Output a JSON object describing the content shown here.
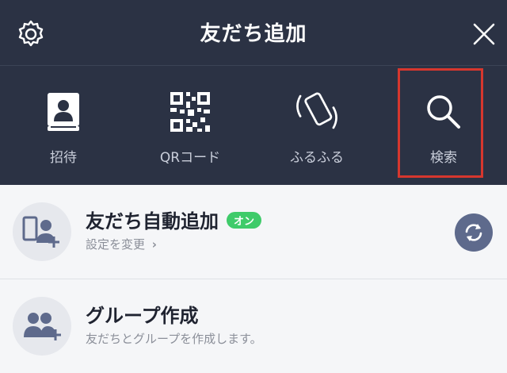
{
  "header": {
    "title": "友だち追加",
    "icons": {
      "left": "gear-icon",
      "right": "close-icon"
    },
    "tabs": [
      {
        "label": "招待",
        "icon": "contact-book-icon"
      },
      {
        "label": "QRコード",
        "icon": "qr-code-icon"
      },
      {
        "label": "ふるふる",
        "icon": "shake-phone-icon"
      },
      {
        "label": "検索",
        "icon": "search-icon"
      }
    ]
  },
  "list": {
    "auto_add": {
      "title": "友だち自動追加",
      "badge": "オン",
      "subtitle": "設定を変更",
      "chevron": "›",
      "icon": "phone-user-add-icon",
      "action_icon": "sync-icon"
    },
    "group": {
      "title": "グループ作成",
      "subtitle": "友だちとグループを作成します。",
      "icon": "group-add-icon"
    }
  },
  "colors": {
    "header_bg": "#2b3244",
    "list_bg": "#f5f6f8",
    "badge_green": "#3fcb6a",
    "highlight_red": "#d6372e",
    "sync_bg": "#5e6a8c"
  }
}
